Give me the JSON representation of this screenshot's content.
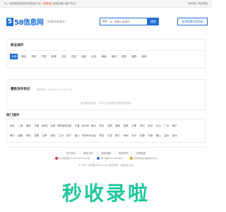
{
  "topbar": {
    "left_prefix": "Hi，欢迎来到发信网分类信息平台！",
    "left_login": "[请登录]",
    "left_suffix": "[免费注册] [用户中心]",
    "right": "58同城 | 网站导航"
  },
  "header": {
    "logo_char": "5",
    "logo_name": "58信息网",
    "city_tag": "[切换其他城市]",
    "search_select": "商业",
    "search_placeholder": "请输入关键词",
    "search_button": "搜索",
    "post_button": "发布免费分类信息"
  },
  "districts": {
    "title": "商业城市",
    "items": [
      "全城",
      "城区",
      "郊区",
      "开发",
      "新城",
      "东区",
      "西区",
      "南区",
      "北区",
      "城南",
      "城北",
      "城东",
      "城西",
      "其他"
    ]
  },
  "latest": {
    "title": "最新发布供应",
    "updated": "更新时间：2026-04-11 10:17:30",
    "empty": "该分类暂无信息 ，您可以 查看其他分类或发布信息"
  },
  "hot_cities": {
    "title": "热门城市",
    "row1": [
      "北京",
      "上海",
      "重庆",
      "天津",
      "石家庄",
      "太原",
      "呼和浩特",
      "沈阳",
      "长春",
      "哈尔滨",
      "南京",
      "杭州",
      "合肥",
      "福州",
      "南昌",
      "济南",
      "郑州",
      "武汉",
      "长沙",
      "广州",
      "南宁"
    ],
    "row2": [
      "海口",
      "成都",
      "贵阳",
      "昆明",
      "拉萨",
      "西安",
      "兰州",
      "西宁",
      "银川",
      "乌鲁木齐",
      "大连",
      "青岛",
      "宁波",
      "厦门",
      "深圳",
      "苏州",
      "无锡",
      "东莞",
      "佛山",
      "温州",
      "泉州"
    ]
  },
  "footer": {
    "links": [
      "关于我们",
      "联系方式",
      "网站地图",
      "免责声明",
      "友情链接"
    ],
    "badges": [
      {
        "icon": "police-badge-icon",
        "text": "京公网安备11010502030143号"
      },
      {
        "icon": "icp-badge-icon",
        "text": "京ICP备09093006号-1"
      },
      {
        "icon": "license-badge-icon",
        "text": "增值电信业务经营许可证"
      }
    ],
    "copyright": "© 2026 58同城 58sxx.com 版权所有 · 分类信息平台"
  },
  "watermark": "秒收录啦",
  "colors": {
    "accent": "#1e6fd9",
    "watermark": "#1fc79b"
  }
}
